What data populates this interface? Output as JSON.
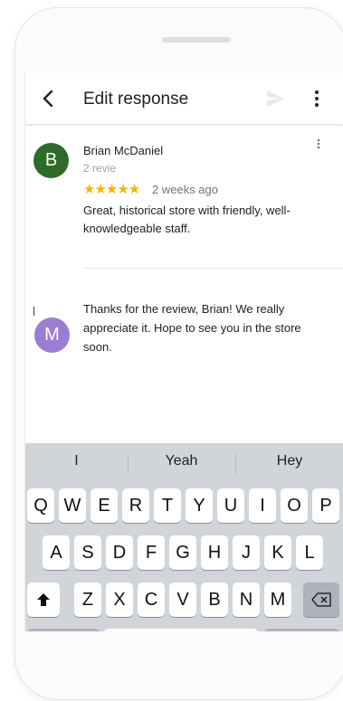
{
  "header": {
    "title": "Edit response"
  },
  "review": {
    "avatar_letter": "B",
    "reviewer": "Brian McDaniel",
    "review_count": "2 revie",
    "stars": "★★★★★",
    "date": "2 weeks ago",
    "text": "Great, historical store with friendly, well-knowledgeable staff."
  },
  "response": {
    "avatar_letter": "M",
    "text": "Thanks for the review, Brian! We really appreciate it. Hope to see you in the store soon."
  },
  "keyboard": {
    "suggestions": [
      "I",
      "Yeah",
      "Hey"
    ],
    "row1": [
      "Q",
      "W",
      "E",
      "R",
      "T",
      "Y",
      "U",
      "I",
      "O",
      "P"
    ],
    "row2": [
      "A",
      "S",
      "D",
      "F",
      "G",
      "H",
      "J",
      "K",
      "L"
    ],
    "row3": [
      "Z",
      "X",
      "C",
      "V",
      "B",
      "N",
      "M"
    ]
  },
  "colors": {
    "avatar_b": "#2e6b28",
    "avatar_m": "#9b7dd4",
    "star": "#f4b400"
  }
}
